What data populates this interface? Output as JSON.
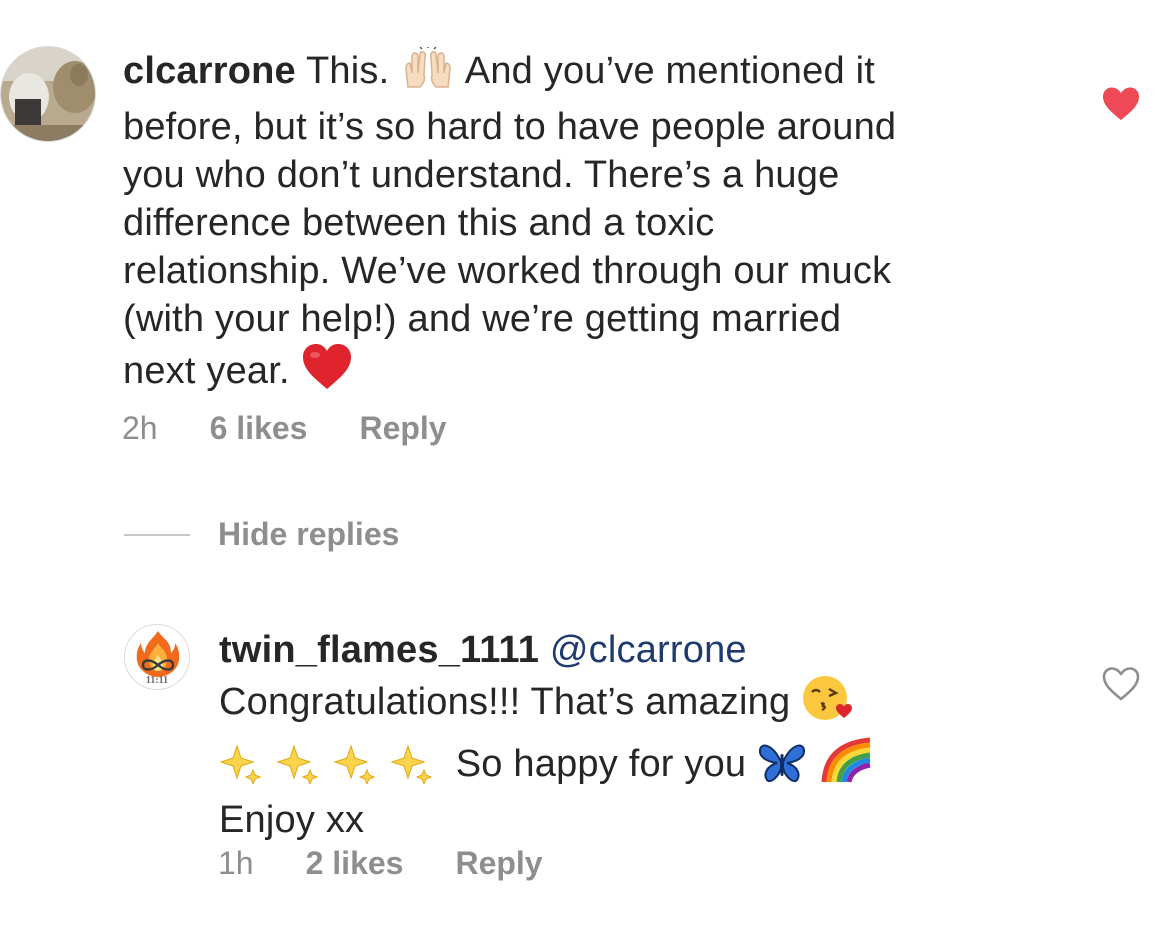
{
  "comment": {
    "username": "clcarrone",
    "text_line1": "This.",
    "text_line1b": "And you’ve mentioned it",
    "text_line2": "before, but it’s so hard to have people around",
    "text_line3": "you who don’t understand. There’s a huge",
    "text_line4": "difference between this and a toxic",
    "text_line5": "relationship. We’ve worked through our muck",
    "text_line6": "(with your help!) and we’re getting married",
    "text_line7": "next year.",
    "time": "2h",
    "likes": "6 likes",
    "reply": "Reply",
    "liked": true,
    "like_color": "#ed4956"
  },
  "hide_replies": "Hide replies",
  "reply": {
    "username": "twin_flames_1111",
    "mention": "@clcarrone",
    "text_line1": "Congratulations!!! That’s amazing",
    "text_line2": "So happy for you",
    "text_line3": "Enjoy xx",
    "avatar_caption": "11:11",
    "time": "1h",
    "likes": "2 likes",
    "reply": "Reply",
    "liked": false
  },
  "icons": {
    "comment_emojis": [
      "raising-hands-icon",
      "red-heart-icon"
    ],
    "reply_emojis": [
      "kissing-face-icon",
      "sparkles-icon",
      "butterfly-icon",
      "rainbow-icon"
    ],
    "like": "heart-icon"
  }
}
